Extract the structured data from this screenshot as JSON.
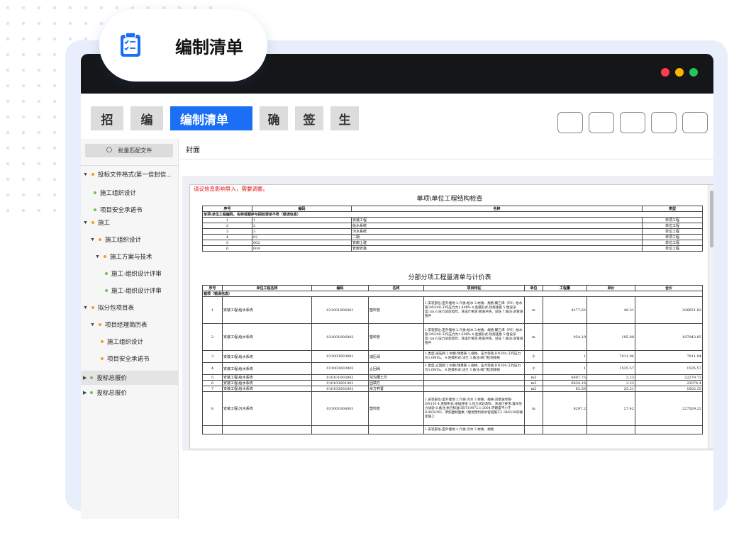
{
  "badge": {
    "title": "编制清单",
    "icon": "clipboard-list-icon"
  },
  "window_controls": [
    {
      "name": "close",
      "color": "#ff3b4d"
    },
    {
      "name": "minimize",
      "color": "#ffb400"
    },
    {
      "name": "maximize",
      "color": "#22c55e"
    }
  ],
  "toolbar": {
    "tabs": [
      "招",
      "编",
      "编制清单",
      "确",
      "签",
      "生"
    ],
    "active": "编制清单"
  },
  "sidebar": {
    "batch_label": "批量匹配文件",
    "items": [
      {
        "label": "投标文件格式(第一信封信...",
        "type": "expand",
        "dot": "#f59d1b"
      },
      {
        "label": "施工组织设计",
        "type": "leaf",
        "dot": "#6fbf52"
      },
      {
        "label": "项目安全承诺书",
        "type": "leaf",
        "dot": "#6fbf52"
      },
      {
        "label": "施工",
        "type": "expand",
        "dot": "#f59d1b"
      },
      {
        "label": "施工组织设计",
        "type": "expand",
        "dot": "#f59d1b"
      },
      {
        "label": "施工方案与技术",
        "type": "expand",
        "dot": "#f59d1b"
      },
      {
        "label": "施工-组织设计评审",
        "type": "leaf",
        "dot": "#6fbf52"
      },
      {
        "label": "施工-组织设计评审",
        "type": "leaf",
        "dot": "#6fbf52"
      },
      {
        "label": "拟分包项目表",
        "type": "expand",
        "dot": "#f59d1b"
      },
      {
        "label": "项目经理简历表",
        "type": "expand",
        "dot": "#f59d1b"
      },
      {
        "label": "施工组织设计",
        "type": "leaf",
        "dot": "#f59d1b"
      },
      {
        "label": "项目安全承诺书",
        "type": "leaf",
        "dot": "#f59d1b"
      },
      {
        "label": "投标总报价",
        "type": "collapsed",
        "dot": "#6fbf52"
      },
      {
        "label": "投标总报价",
        "type": "collapsed",
        "dot": "#6fbf52"
      }
    ]
  },
  "breadcrumb": "封面",
  "document": {
    "warning": "请议信息影响导入，需要调整。",
    "table1": {
      "title": "单项\\单位工程结构检查",
      "headers": [
        "序号",
        "编码",
        "名称",
        "类型"
      ],
      "group": "单项\\单位工程编码、名称或顺序与招标清单不符（错误信息）",
      "rows": [
        [
          "1",
          "1",
          "安装工程",
          "单项工程"
        ],
        [
          "2",
          "2",
          "给水系统",
          "单位工程"
        ],
        [
          "3",
          "3",
          "污水系统",
          "单位工程"
        ],
        [
          "4",
          "02",
          "二期",
          "单项工程"
        ],
        [
          "5",
          "002",
          "管廊土建",
          "单位工程"
        ],
        [
          "6",
          "004",
          "管廊安装",
          "单位工程"
        ]
      ]
    },
    "table2": {
      "title": "分部分项工程量清单与计价表",
      "headers": [
        "序号",
        "单位工程名称",
        "编码",
        "名称",
        "项目特征",
        "单位",
        "工程量",
        "单价",
        "合价"
      ],
      "group": "错项（错误信息）",
      "rows": [
        [
          "1",
          "安装工程\\给水系统",
          "031001006001",
          "塑料管",
          "1.安装部位:室外埋地 2.介质:给水 3.材质、规格:聚乙烯（PE）给水管-DN200-工作压力为1.6MPa 4.连接形式:热熔连接 5.埋设深度:1m 6.压力试验及吹、洗设计要求:管道冲洗、试压 7.备注:含管道管件",
          "m",
          "4277.62",
          "48.31",
          "206651.82"
        ],
        [
          "2",
          "安装工程\\给水系统",
          "031001006002",
          "塑料管",
          "1.安装部位:室外埋地 2.介质:给水 3.材质、规格:聚乙烯（PE）给水管-DN200-工作压力为1.6MPa 4.连接形式:热熔连接 5.埋设深度:1m 6.压力试验及吹、洗设计要求:管道冲洗、试压 7.备注:含管道管件",
          "m",
          "954.19",
          "195.88",
          "187043.85"
        ],
        [
          "3",
          "安装工程\\给水系统",
          "031003003001",
          "减压阀",
          "1.类型:减压阀 2.材质:球墨铸 3.规格、压力等级:DN200-工作压力为1.6MPa。 4.连接形式:法兰 5.备注:阀门检测接线",
          "个",
          "1",
          "7011.94",
          "7011.94"
        ],
        [
          "4",
          "安装工程\\给水系统",
          "031003003002",
          "止回阀",
          "1.类型:止回阀 2.材质:球墨铸 3.规格、压力等级:DN200-工作压力为1.6MPa。 4.连接形式:法兰 5.备注:阀门检测接线",
          "个",
          "1",
          "1535.57",
          "1535.57"
        ],
        [
          "5",
          "安装工程\\给水系统",
          "010101003001",
          "挖沟槽土方",
          "",
          "m3",
          "6897.75",
          "3.23",
          "22279.73"
        ],
        [
          "6",
          "安装工程\\给水系统",
          "010103001001",
          "回填方",
          "",
          "m3",
          "6834.18",
          "3.22",
          "22074.4"
        ],
        [
          "7",
          "安装工程\\给水系统",
          "010103002001",
          "余方弃置",
          "",
          "m3",
          "63.56",
          "25.21",
          "1602.35"
        ],
        [
          "8",
          "安装工程\\污水系统",
          "031001006001",
          "塑料管",
          "1.安装部位:室外埋地 2.介质:污水 3.材质、规格:双壁波纹管-DN150 4.连接形式:承插连接 5.压力试验及吹、洗设计要求:灌水压力试验 6.备注:执行标准GB/T19472.1-2004,环刚度不小于8.0KN/M2，参照图标图集《埋地塑料排水管道施工》04S520的规定施工",
          "m",
          "8297.2",
          "27.42",
          "227509.22"
        ],
        [
          "",
          "",
          "",
          "",
          "1.安装部位:室外埋地 2.介质:污水 3.材质、规格",
          "",
          "",
          "",
          ""
        ]
      ]
    }
  }
}
